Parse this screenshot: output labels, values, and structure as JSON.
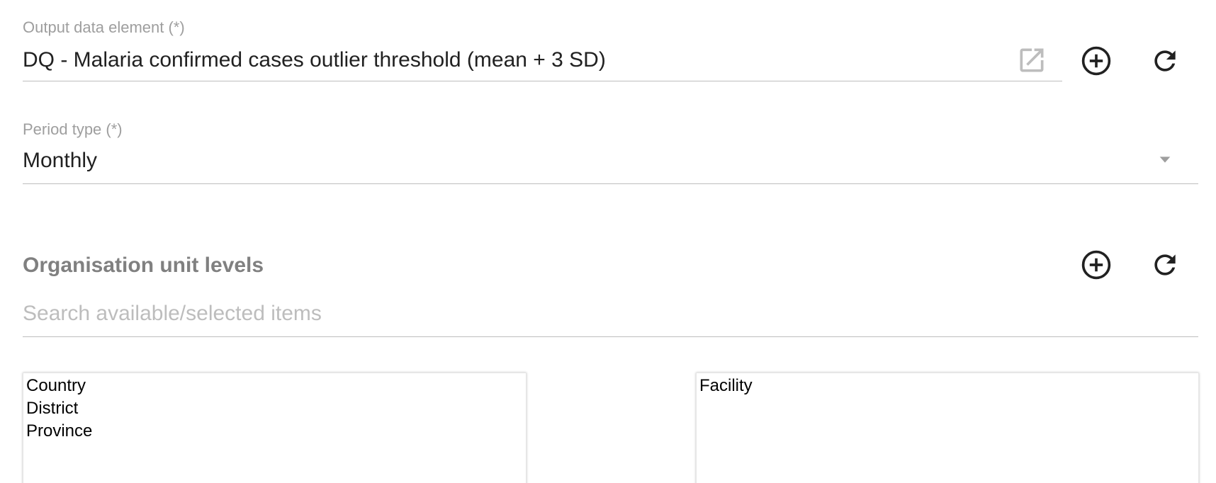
{
  "output_data_element": {
    "label": "Output data element (*)",
    "value": "DQ - Malaria confirmed cases outlier threshold (mean + 3 SD)"
  },
  "period_type": {
    "label": "Period type (*)",
    "value": "Monthly"
  },
  "org_unit_levels": {
    "title": "Organisation unit levels",
    "search_placeholder": "Search available/selected items",
    "available": [
      "Country",
      "District",
      "Province"
    ],
    "selected": [
      "Facility"
    ]
  },
  "icons": {
    "open": "open-in-new-icon",
    "add": "add-circle-icon",
    "refresh": "refresh-icon",
    "dropdown": "arrow-drop-down-icon"
  },
  "colors": {
    "label": "#9e9e9e",
    "text": "#212121",
    "placeholder": "#bdbdbd",
    "underline": "#bdbdbd",
    "section_title": "#808080"
  }
}
